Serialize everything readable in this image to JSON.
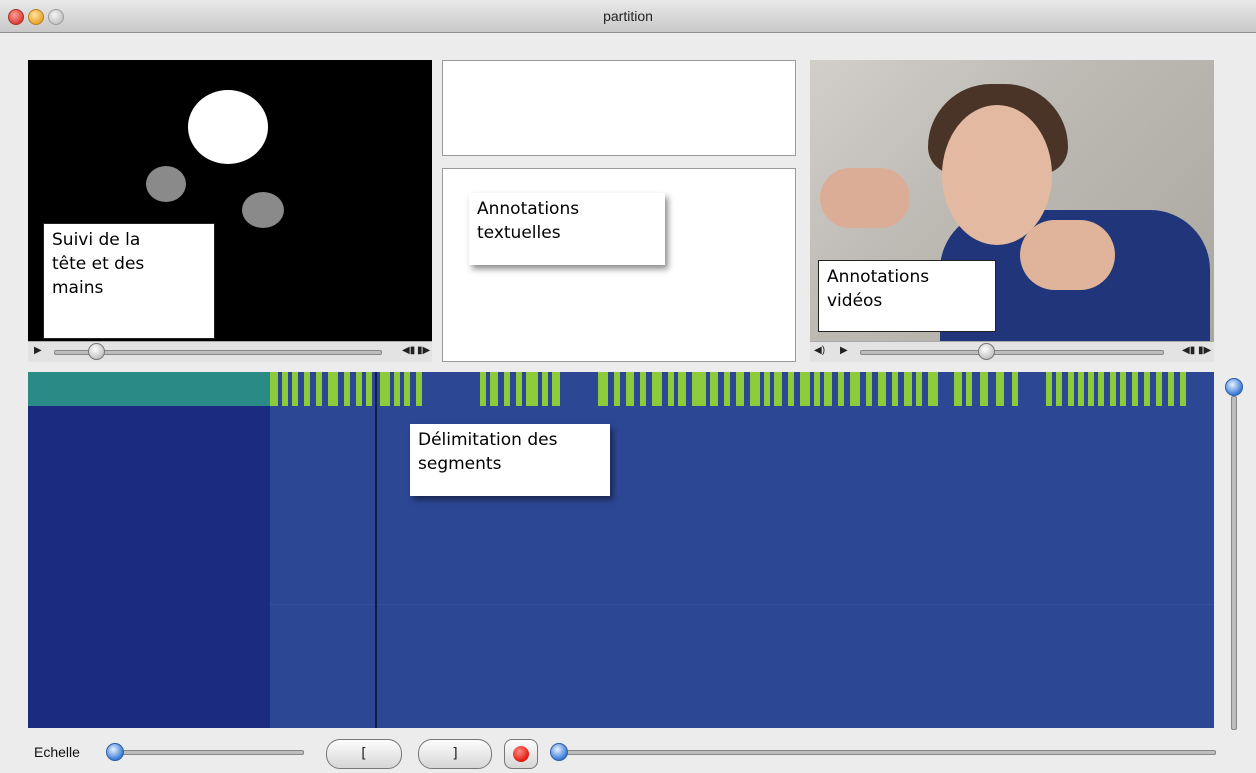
{
  "window": {
    "title": "partition"
  },
  "left_video": {
    "label": "Suivi de la\ntête et des\nmains",
    "play_icon": "play-icon",
    "progress": 0.1
  },
  "text_panel": {
    "label": "Annotations\ntextuelles"
  },
  "right_video": {
    "label": "Annotations\nvidéos",
    "progress": 0.42
  },
  "timeline": {
    "label": "Délimitation des\nsegments",
    "segment_color": "#8ccc3a",
    "background_color": "#2c4794"
  },
  "bottom": {
    "scale_label": "Echelle",
    "open_bracket": "[",
    "close_bracket": "]",
    "record_icon": "record-icon"
  }
}
